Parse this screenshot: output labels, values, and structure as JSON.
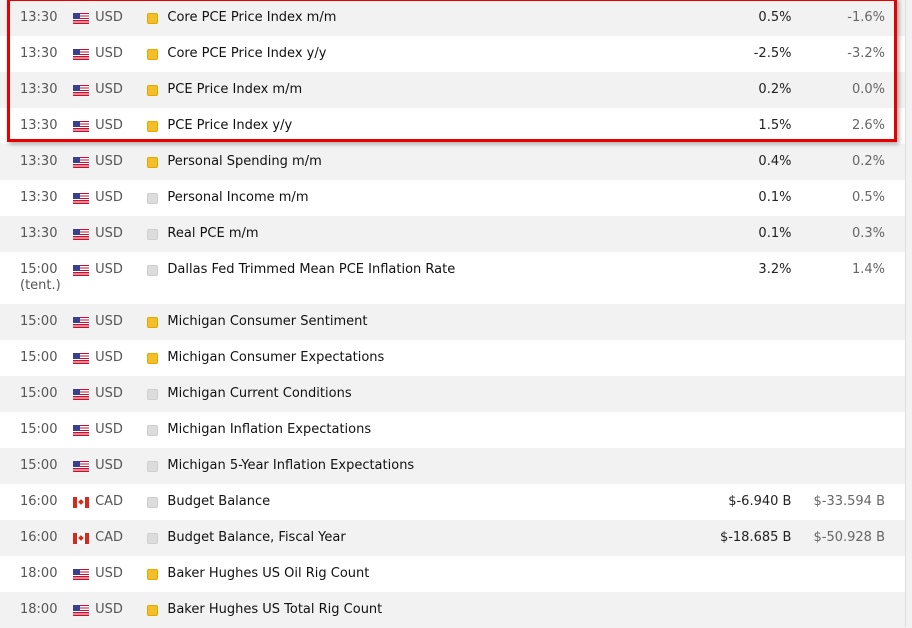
{
  "rows": [
    {
      "time": "13:30",
      "tent": "",
      "currency": "USD",
      "flag": "us",
      "importance": "high",
      "event": "Core PCE Price Index m/m",
      "actual": "0.5%",
      "previous": "-1.6%"
    },
    {
      "time": "13:30",
      "tent": "",
      "currency": "USD",
      "flag": "us",
      "importance": "high",
      "event": "Core PCE Price Index y/y",
      "actual": "-2.5%",
      "previous": "-3.2%"
    },
    {
      "time": "13:30",
      "tent": "",
      "currency": "USD",
      "flag": "us",
      "importance": "high",
      "event": "PCE Price Index m/m",
      "actual": "0.2%",
      "previous": "0.0%"
    },
    {
      "time": "13:30",
      "tent": "",
      "currency": "USD",
      "flag": "us",
      "importance": "high",
      "event": "PCE Price Index y/y",
      "actual": "1.5%",
      "previous": "2.6%"
    },
    {
      "time": "13:30",
      "tent": "",
      "currency": "USD",
      "flag": "us",
      "importance": "high",
      "event": "Personal Spending m/m",
      "actual": "0.4%",
      "previous": "0.2%"
    },
    {
      "time": "13:30",
      "tent": "",
      "currency": "USD",
      "flag": "us",
      "importance": "low",
      "event": "Personal Income m/m",
      "actual": "0.1%",
      "previous": "0.5%"
    },
    {
      "time": "13:30",
      "tent": "",
      "currency": "USD",
      "flag": "us",
      "importance": "low",
      "event": "Real PCE m/m",
      "actual": "0.1%",
      "previous": "0.3%"
    },
    {
      "time": "15:00",
      "tent": "(tent.)",
      "currency": "USD",
      "flag": "us",
      "importance": "low",
      "event": "Dallas Fed Trimmed Mean PCE Inflation Rate",
      "actual": "3.2%",
      "previous": "1.4%"
    },
    {
      "time": "15:00",
      "tent": "",
      "currency": "USD",
      "flag": "us",
      "importance": "high",
      "event": "Michigan Consumer Sentiment",
      "actual": "",
      "previous": ""
    },
    {
      "time": "15:00",
      "tent": "",
      "currency": "USD",
      "flag": "us",
      "importance": "high",
      "event": "Michigan Consumer Expectations",
      "actual": "",
      "previous": ""
    },
    {
      "time": "15:00",
      "tent": "",
      "currency": "USD",
      "flag": "us",
      "importance": "low",
      "event": "Michigan Current Conditions",
      "actual": "",
      "previous": ""
    },
    {
      "time": "15:00",
      "tent": "",
      "currency": "USD",
      "flag": "us",
      "importance": "low",
      "event": "Michigan Inflation Expectations",
      "actual": "",
      "previous": ""
    },
    {
      "time": "15:00",
      "tent": "",
      "currency": "USD",
      "flag": "us",
      "importance": "low",
      "event": "Michigan 5-Year Inflation Expectations",
      "actual": "",
      "previous": ""
    },
    {
      "time": "16:00",
      "tent": "",
      "currency": "CAD",
      "flag": "ca",
      "importance": "low",
      "event": "Budget Balance",
      "actual": "$-6.940 B",
      "previous": "$-33.594 B"
    },
    {
      "time": "16:00",
      "tent": "",
      "currency": "CAD",
      "flag": "ca",
      "importance": "low",
      "event": "Budget Balance, Fiscal Year",
      "actual": "$-18.685 B",
      "previous": "$-50.928 B"
    },
    {
      "time": "18:00",
      "tent": "",
      "currency": "USD",
      "flag": "us",
      "importance": "high",
      "event": "Baker Hughes US Oil Rig Count",
      "actual": "",
      "previous": ""
    },
    {
      "time": "18:00",
      "tent": "",
      "currency": "USD",
      "flag": "us",
      "importance": "high",
      "event": "Baker Hughes US Total Rig Count",
      "actual": "",
      "previous": ""
    }
  ],
  "colors": {
    "highlight": "#e60000",
    "high_importance": "#f4be28",
    "low_importance": "#dcdcdc"
  }
}
